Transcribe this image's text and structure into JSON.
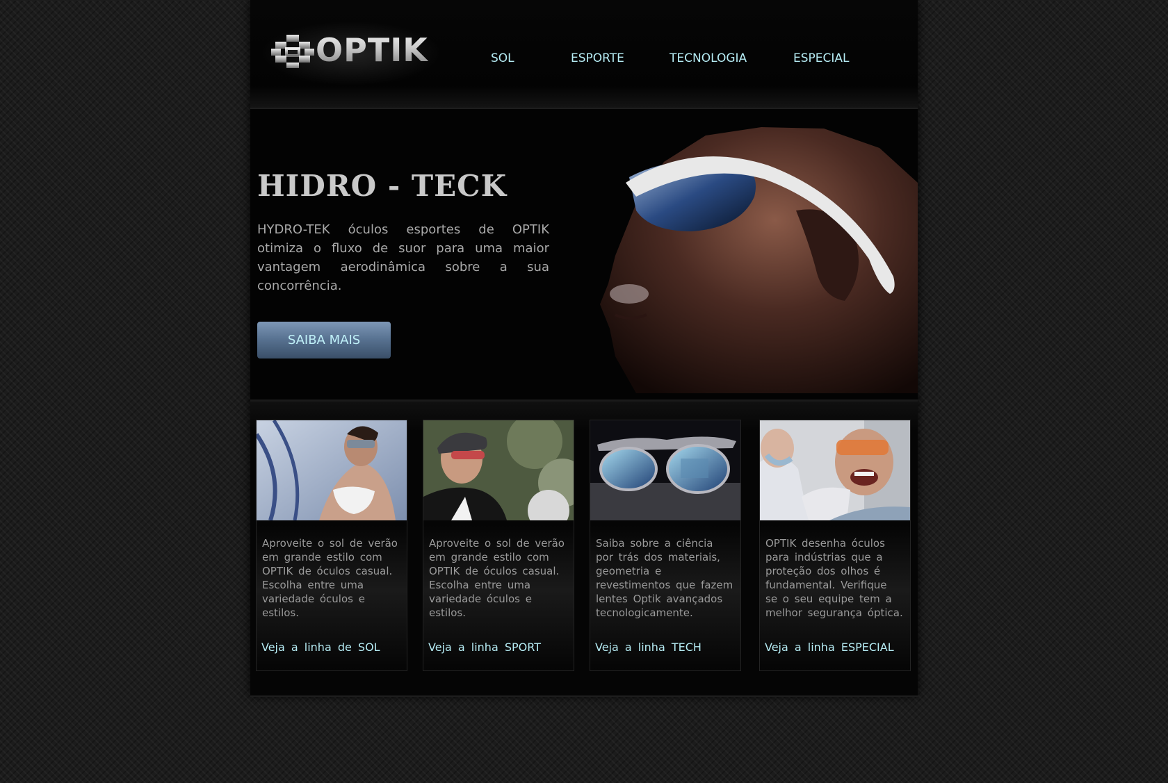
{
  "brand": {
    "logo_text": "OPTIK"
  },
  "nav": {
    "items": [
      {
        "label": "SOL"
      },
      {
        "label": "ESPORTE"
      },
      {
        "label": "TECNOLOGIA"
      },
      {
        "label": "ESPECIAL"
      }
    ]
  },
  "hero": {
    "title": "HIDRO - TECK",
    "description": "HYDRO-TEK óculos esportes de OPTIK otimiza o fluxo de suor para uma maior vantagem aerodinâmica sobre a sua concorrência.",
    "button_label": "SAIBA MAIS"
  },
  "cards": [
    {
      "text": "Aproveite o sol de verão em grande estilo com OPTIK de óculos casual. Escolha entre uma variedade óculos e estilos.",
      "link": "Veja a linha de SOL"
    },
    {
      "text": "Aproveite o sol de verão em grande estilo com OPTIK de óculos casual. Escolha entre uma variedade óculos e estilos.",
      "link": "Veja a linha SPORT"
    },
    {
      "text": "Saiba sobre a ciência por trás dos materiais, geometria e revestimentos que fazem lentes Optik avançados tecnologicamente.",
      "link": "Veja a linha TECH"
    },
    {
      "text": "OPTIK desenha óculos para indústrias que a proteção dos olhos é fundamental. Verifique se o seu equipe tem a melhor segurança óptica.",
      "link": "Veja a linha ESPECIAL"
    }
  ],
  "colors": {
    "nav_link": "#b6ecf4",
    "button_top": "#7d97b6",
    "button_bottom": "#3a4f68",
    "page_background": "#050505"
  }
}
